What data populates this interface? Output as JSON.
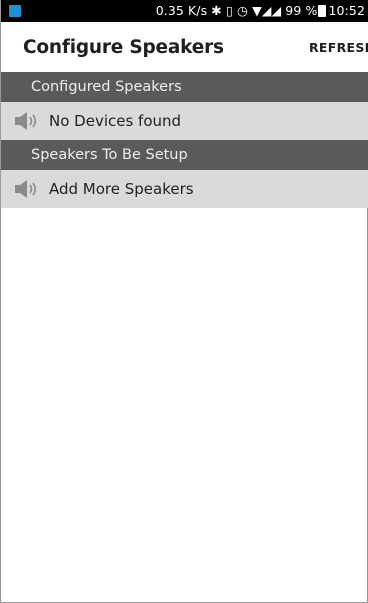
{
  "status_bar": {
    "speed": "0.35 K/s",
    "glyphs": "✱ ▯ ◷ ▼◢◢",
    "battery": "99 %",
    "time": "10:52"
  },
  "toolbar": {
    "title": "Configure Speakers",
    "refresh_label": "REFRESH"
  },
  "sections": {
    "configured": {
      "header": "Configured Speakers",
      "item": "No Devices found",
      "icon": "speaker-icon"
    },
    "setup": {
      "header": "Speakers To Be Setup",
      "item": "Add More Speakers",
      "icon": "speaker-icon"
    }
  },
  "colors": {
    "header_bg": "#5a5a5a",
    "row_bg": "#dadada",
    "status_bg": "#000000",
    "app_icon": "#1e90d6"
  }
}
